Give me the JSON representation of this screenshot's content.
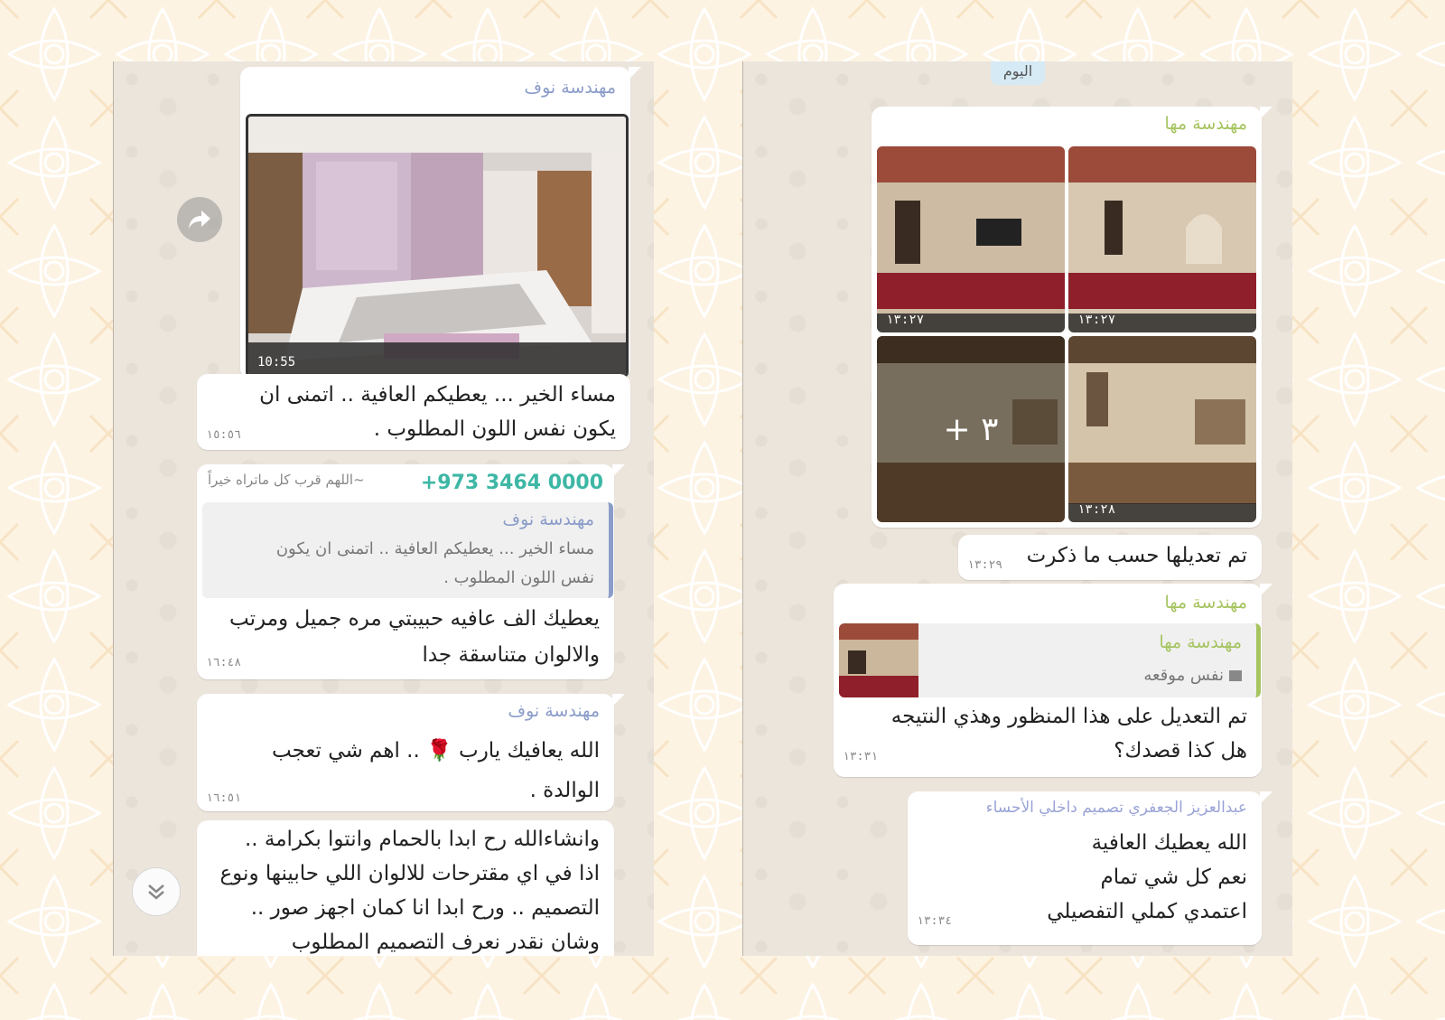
{
  "colors": {
    "page_bg": "#fdf3e3",
    "chat_bg": "#ece5dc",
    "name_noof": "#8b9cc9",
    "name_maha": "#a6c460",
    "name_phone": "#3eb7a5",
    "name_aziz": "#9aa3d6",
    "quote_bar_noof": "#8b9cc9",
    "quote_bar_maha": "#a6c460"
  },
  "left_chat": {
    "m1": {
      "sender": "مهندسة نوف",
      "image_time": "10:55",
      "image_caption_icon": "bedroom-render-image"
    },
    "m2": {
      "line1": "مساء الخير ... يعطيكم العافية .. اتمنى ان",
      "line2": "يكون نفس اللون المطلوب .",
      "time": "١٥:٥٦"
    },
    "m3": {
      "phone": "+973 3464 0000",
      "status": "~اللهم قرب كل ماتراه خيراً",
      "quote_name": "مهندسة نوف",
      "quote_line1": "مساء الخير ... يعطيكم العافية .. اتمنى ان يكون",
      "quote_line2": "نفس اللون المطلوب .",
      "line1": "يعطيك الف عافيه حبيبتي مره جميل ومرتب",
      "line2": "والالوان متناسقة جدا",
      "time": "١٦:٤٨"
    },
    "m4": {
      "sender": "مهندسة نوف",
      "line1": "الله يعافيك يارب 🌹 .. اهم شي تعجب",
      "line2": "الوالدة .",
      "time": "١٦:٥١"
    },
    "m5": {
      "line1": "وانشاءالله رح ابدا بالحمام وانتوا بكرامة ..",
      "line2": "اذا في اي مقترحات للالوان اللي حابينها ونوع",
      "line3": "التصميم .. ورح ابدا انا كمان اجهز صور ..",
      "line4": "وشان نقدر نعرف التصميم المطلوب"
    }
  },
  "right_chat": {
    "date_chip": "اليوم",
    "m1": {
      "sender": "مهندسة مها",
      "times": [
        "١٣:٢٧",
        "١٣:٢٧",
        "",
        "١٣:٢٨"
      ],
      "more_count": "+ ٣"
    },
    "m2": {
      "text": "تم تعديلها حسب ما ذكرت",
      "time": "١٣:٢٩"
    },
    "m3": {
      "sender": "مهندسة مها",
      "quote_name": "مهندسة مها",
      "quote_text": "نفس موقعه",
      "line1": "تم التعديل على هذا المنظور وهذي النتيجه",
      "line2": "هل كذا قصدك؟",
      "time": "١٣:٣١"
    },
    "m4": {
      "sender": "عبدالعزيز الجعفري تصميم داخلي الأحساء",
      "line1": "الله يعطيك العافية",
      "line2": "نعم كل شي تمام",
      "line3": "اعتمدي كملي التفصيلي",
      "time": "١٣:٣٤"
    }
  },
  "icons": {
    "forward": "forward-icon",
    "scroll_down": "double-chevron-down-icon",
    "photo": "photo-icon"
  }
}
